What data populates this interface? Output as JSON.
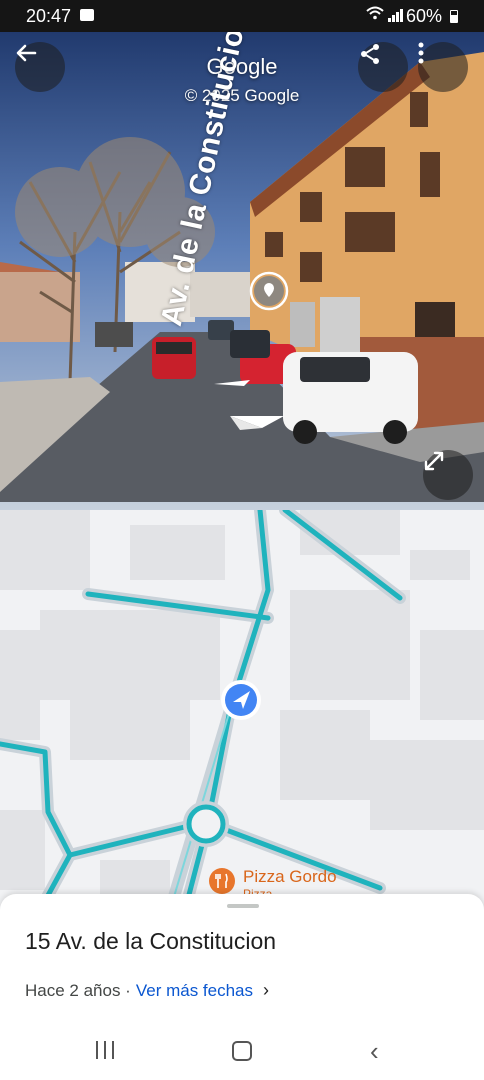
{
  "status_bar": {
    "time": "20:47",
    "battery": "60%",
    "icons": [
      "image-icon",
      "wifi-icon",
      "signal-icon",
      "battery-icon"
    ]
  },
  "street_view": {
    "title": "Google",
    "copyright": "© 2025 Google",
    "street_label": "Av. de la Constitucion",
    "buttons": [
      "back-arrow-icon",
      "share-icon",
      "more-vert-icon",
      "expand-icon"
    ]
  },
  "map": {
    "poi_name": "Pizza Gordo",
    "poi_sub": "Pizza",
    "colors": {
      "road": "#1fb3bd",
      "road_outline": "#c9d2d9",
      "building": "#e2e3e6",
      "location": "#4285f4",
      "poi": "#e8762c"
    }
  },
  "bottom_sheet": {
    "address": "15 Av. de la Constitucion",
    "date_text": "Hace 2 años ·",
    "more_dates_link": "Ver más fechas",
    "chevron": "›"
  },
  "nav_bar": {
    "back_glyph": "‹"
  }
}
